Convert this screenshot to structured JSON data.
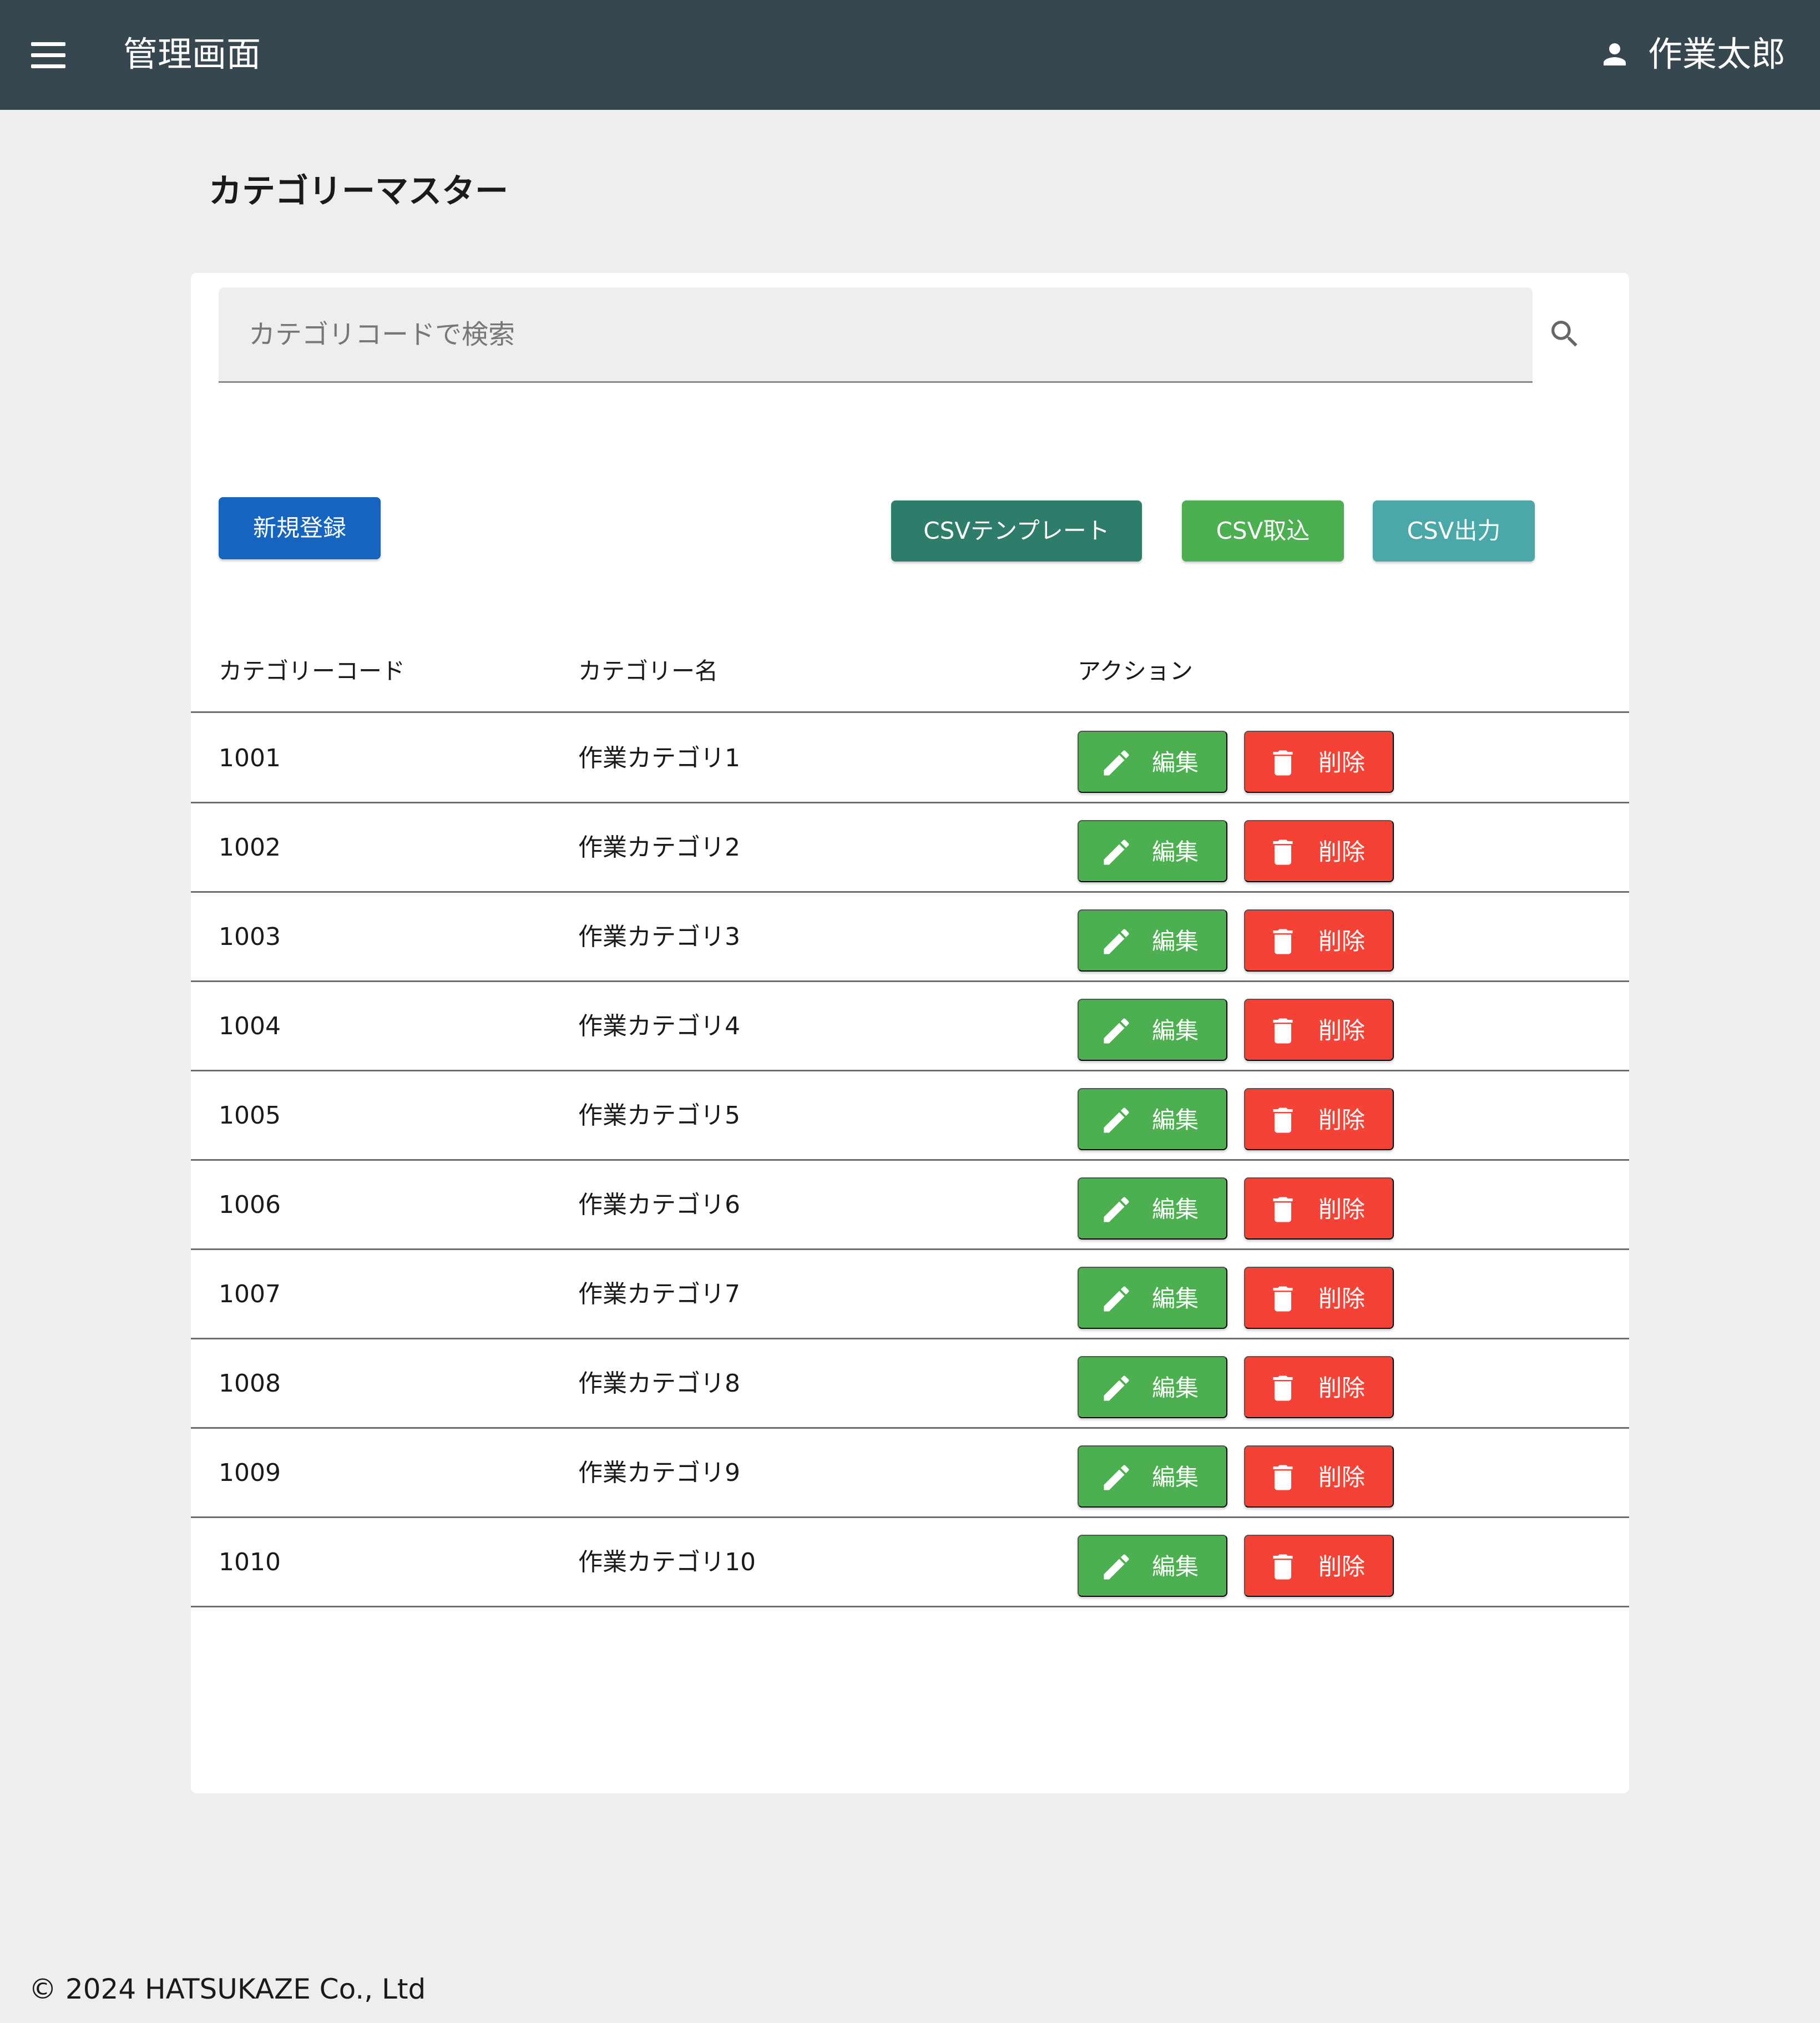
{
  "header": {
    "title": "管理画面",
    "user_name": "作業太郎"
  },
  "page": {
    "title": "カテゴリーマスター"
  },
  "search": {
    "placeholder": "カテゴリコードで検索",
    "value": ""
  },
  "toolbar": {
    "new_label": "新規登録",
    "csv_template_label": "CSVテンプレート",
    "csv_import_label": "CSV取込",
    "csv_export_label": "CSV出力"
  },
  "table": {
    "columns": [
      "カテゴリーコード",
      "カテゴリー名",
      "アクション"
    ],
    "edit_label": "編集",
    "delete_label": "削除",
    "rows": [
      {
        "code": "1001",
        "name": "作業カテゴリ1"
      },
      {
        "code": "1002",
        "name": "作業カテゴリ2"
      },
      {
        "code": "1003",
        "name": "作業カテゴリ3"
      },
      {
        "code": "1004",
        "name": "作業カテゴリ4"
      },
      {
        "code": "1005",
        "name": "作業カテゴリ5"
      },
      {
        "code": "1006",
        "name": "作業カテゴリ6"
      },
      {
        "code": "1007",
        "name": "作業カテゴリ7"
      },
      {
        "code": "1008",
        "name": "作業カテゴリ8"
      },
      {
        "code": "1009",
        "name": "作業カテゴリ9"
      },
      {
        "code": "1010",
        "name": "作業カテゴリ10"
      }
    ]
  },
  "footer": {
    "copyright": "© 2024 HATSUKAZE Co., Ltd"
  },
  "icons": {
    "menu": "menu-icon",
    "user": "person-icon",
    "search": "search-icon",
    "edit": "pencil-icon",
    "delete": "trash-icon"
  },
  "colors": {
    "appbar": "#37474f",
    "primary": "#1565c0",
    "csv_template": "#2e7d6b",
    "csv_import": "#4caf50",
    "csv_export": "#4aa8a8",
    "edit": "#4caf50",
    "delete": "#f44336"
  }
}
